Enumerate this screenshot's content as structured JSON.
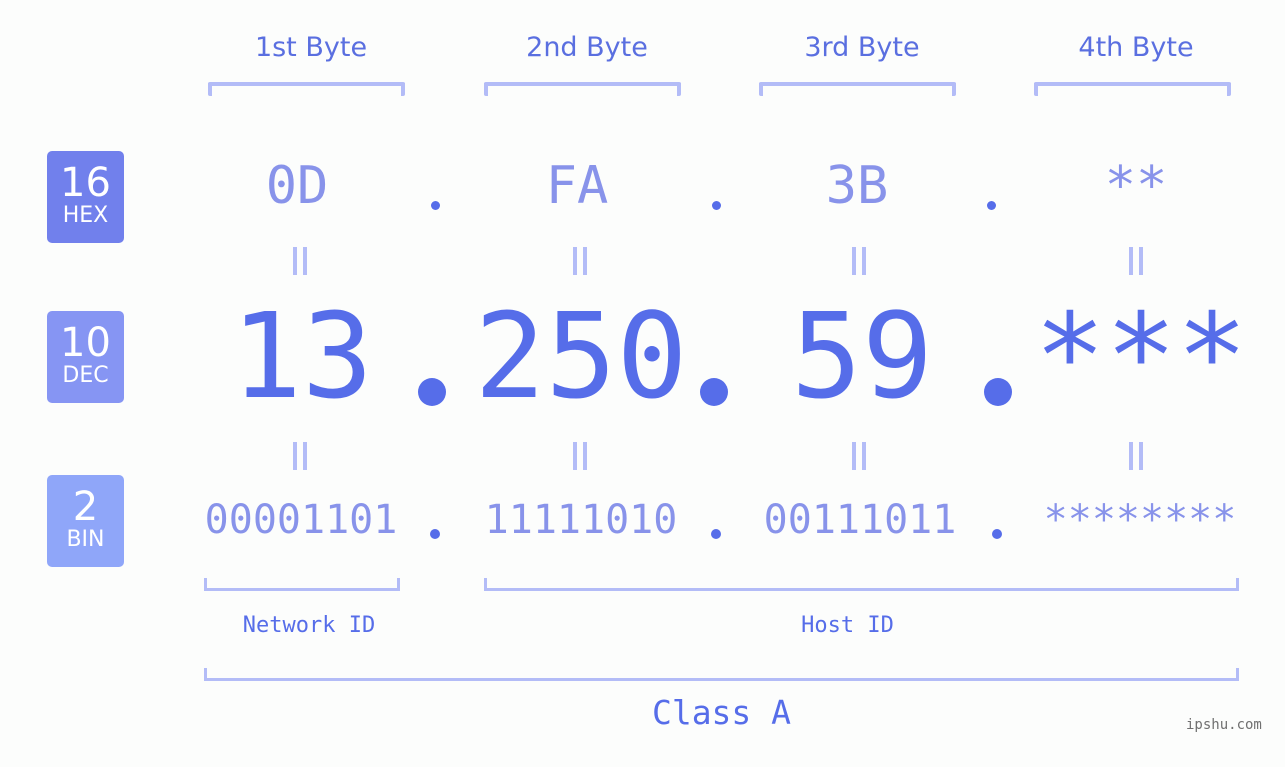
{
  "colors": {
    "hex_badge": "#7180ec",
    "dec_badge": "#8695f3",
    "bin_badge": "#8fa6f9",
    "accent": "#566de9",
    "light_value": "#8893ea",
    "bracket": "#b3bcf7"
  },
  "badges": [
    {
      "number": "16",
      "label": "HEX"
    },
    {
      "number": "10",
      "label": "DEC"
    },
    {
      "number": "2",
      "label": "BIN"
    }
  ],
  "byte_headers": [
    "1st Byte",
    "2nd Byte",
    "3rd Byte",
    "4th Byte"
  ],
  "hex": [
    "0D",
    "FA",
    "3B",
    "**"
  ],
  "dec": [
    "13",
    "250",
    "59",
    "***"
  ],
  "bin": [
    "00001101",
    "11111010",
    "00111011",
    "********"
  ],
  "separator": ".",
  "equals_symbol": "equals-vertical-icon",
  "network_id_label": "Network ID",
  "host_id_label": "Host ID",
  "class_label": "Class A",
  "watermark": "ipshu.com"
}
